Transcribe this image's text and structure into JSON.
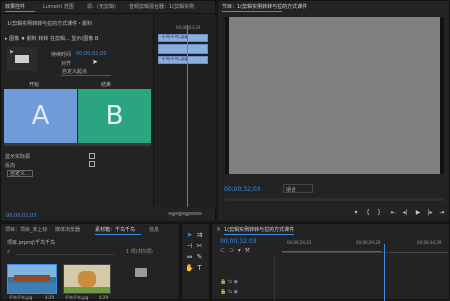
{
  "effect_controls": {
    "tabs": [
      "效果控件",
      "Lumetri 范围",
      "源：(无剪辑)",
      "音频剪辑混合器：1(剪辑实例"
    ],
    "active_tab_index": 0,
    "sequence_line": "1(剪辑实例转转与拉的方式课件・颜料",
    "clip_line": "图像 ♦ 颜料 转转 在剪辑... 显示(图像 B·",
    "timecode": "00;00;02;00",
    "hold_label": "持续时间",
    "alignment_label": "对齐",
    "alignment_value": "自定义起点",
    "start_label": "开始",
    "end_label": "结束",
    "pane_a": "A",
    "pane_b": "B",
    "show_actual_source": "显示实际源",
    "reverse": "反向",
    "custom_button": "自定义…",
    "footer_timecode": "00;00;02;03"
  },
  "mini_timeline": {
    "ruler_time": "00;00;03;29",
    "clip1": "千鸟千鸟.jpg",
    "clip2": "千鸟千鸟.jpg"
  },
  "program_monitor": {
    "title": "节目：1(剪辑实例转转与拉的方式课件",
    "timecode": "00;00;32;03",
    "fit_label": "适合",
    "controls": [
      "marker-icon",
      "in-icon",
      "out-icon",
      "step-back-icon",
      "step-back-frame-icon",
      "play-icon",
      "step-forward-frame-icon",
      "step-forward-icon"
    ]
  },
  "project_panel": {
    "tabs": [
      "项目：项目_未上标",
      "媒体浏览器",
      "素材箱：千鸟千鸟",
      "信息"
    ],
    "active_tab_index": 2,
    "path": "项目.prproj\\千鸟千鸟",
    "item_count": "1 项(共5项)",
    "items": [
      {
        "label": "千鸟千鸟.jpg",
        "duration": "4;29"
      },
      {
        "label": "千鸟千鸟.jpg",
        "duration": "4;29"
      },
      {
        "label": "",
        "duration": ""
      }
    ]
  },
  "timeline": {
    "title": "1(剪辑实例转转与拉的方式课件",
    "timecode": "00;00;32;03",
    "ruler": [
      "00;00;24;23",
      "00;00;29;29",
      "00;00;34;29"
    ]
  },
  "colors": {
    "accent": "#3a8ee6",
    "pane_a": "#6f9bd8",
    "pane_b": "#2aa57f",
    "clip": "#8aaee0"
  }
}
